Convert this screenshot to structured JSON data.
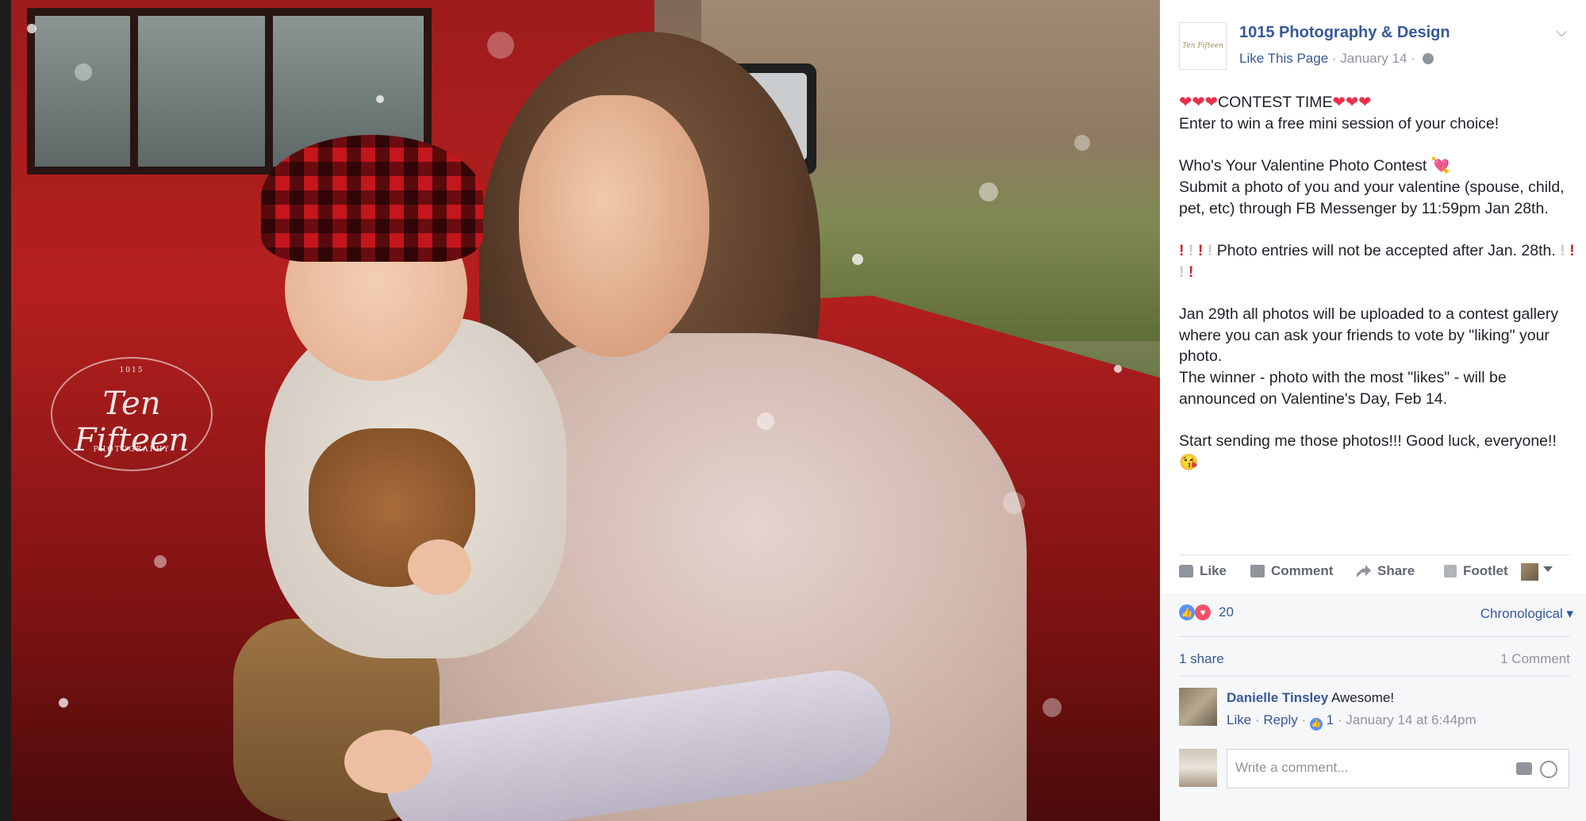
{
  "photo": {
    "watermark": {
      "top": "1015",
      "main": "Ten Fifteen",
      "sub": "PHOTOGRAPHY"
    }
  },
  "post": {
    "page_name": "1015 Photography & Design",
    "page_logo_text": "Ten Fifteen",
    "like_page": "Like This Page",
    "date": "January 14",
    "text": {
      "contest_title": "CONTEST TIME",
      "hearts": "❤❤❤",
      "line1": "Enter to win a free mini session of your choice!",
      "para2_title": "Who's Your Valentine Photo Contest 💘",
      "para2_body": "Submit a photo of you and your valentine (spouse, child, pet, etc) through FB Messenger by 11:59pm Jan 28th.",
      "para3": "Photo entries will not be accepted after Jan. 28th.",
      "para4a": "Jan 29th all photos will be uploaded to a contest gallery where you can ask your friends to vote by \"liking\" your photo.",
      "para4b": "The winner - photo with the most \"likes\" - will be announced on Valentine's Day, Feb 14.",
      "para5": "Start sending me those photos!!! Good luck, everyone!! 😘"
    },
    "actions": {
      "like": "Like",
      "comment": "Comment",
      "share": "Share",
      "footlet": "Footlet"
    },
    "reactions_count": "20",
    "sort": "Chronological",
    "shares": "1 share",
    "comments_count": "1 Comment",
    "comment": {
      "author": "Danielle Tinsley",
      "text": "Awesome!",
      "like": "Like",
      "reply": "Reply",
      "likes": "1",
      "time": "January 14 at 6:44pm"
    },
    "comment_placeholder": "Write a comment..."
  },
  "colors": {
    "link": "#365899",
    "meta": "#90949c",
    "text": "#1d2129",
    "heart": "#e8304a"
  }
}
